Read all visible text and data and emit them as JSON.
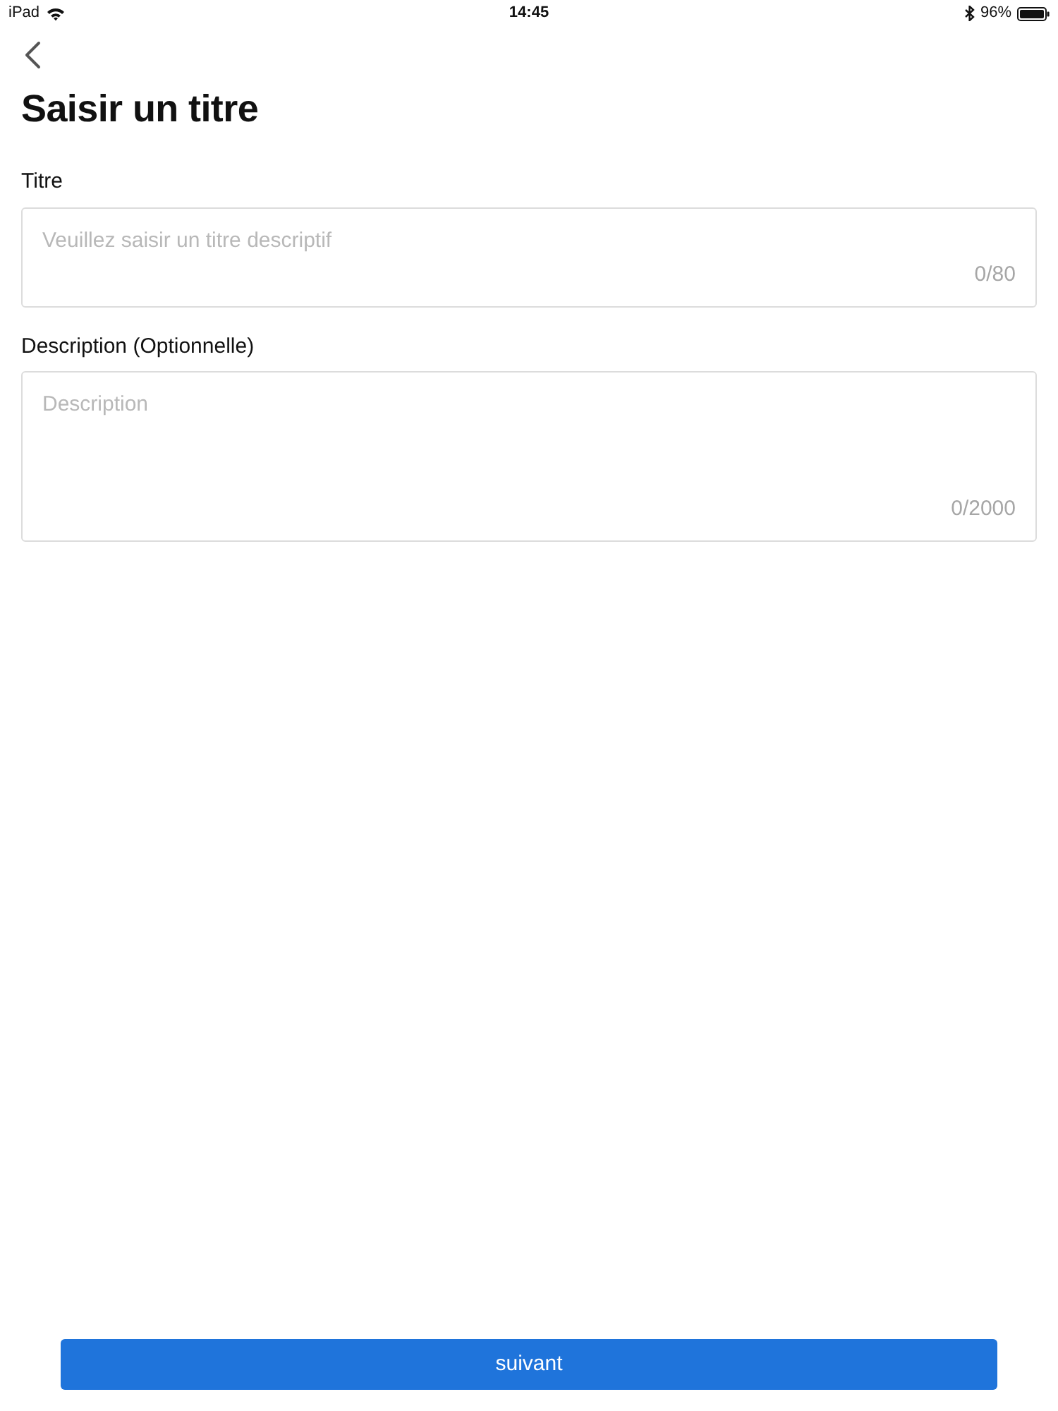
{
  "status_bar": {
    "device": "iPad",
    "time": "14:45",
    "battery": "96%"
  },
  "header": {
    "title": "Saisir un titre"
  },
  "fields": [
    {
      "kind": "input",
      "label": "Titre",
      "placeholder": "Veuillez saisir un titre descriptif",
      "counter": "0/80"
    },
    {
      "kind": "textarea",
      "label": "Description (Optionnelle)",
      "placeholder": "Description",
      "counter": "0/2000"
    }
  ],
  "footer": {
    "button": "suivant"
  }
}
